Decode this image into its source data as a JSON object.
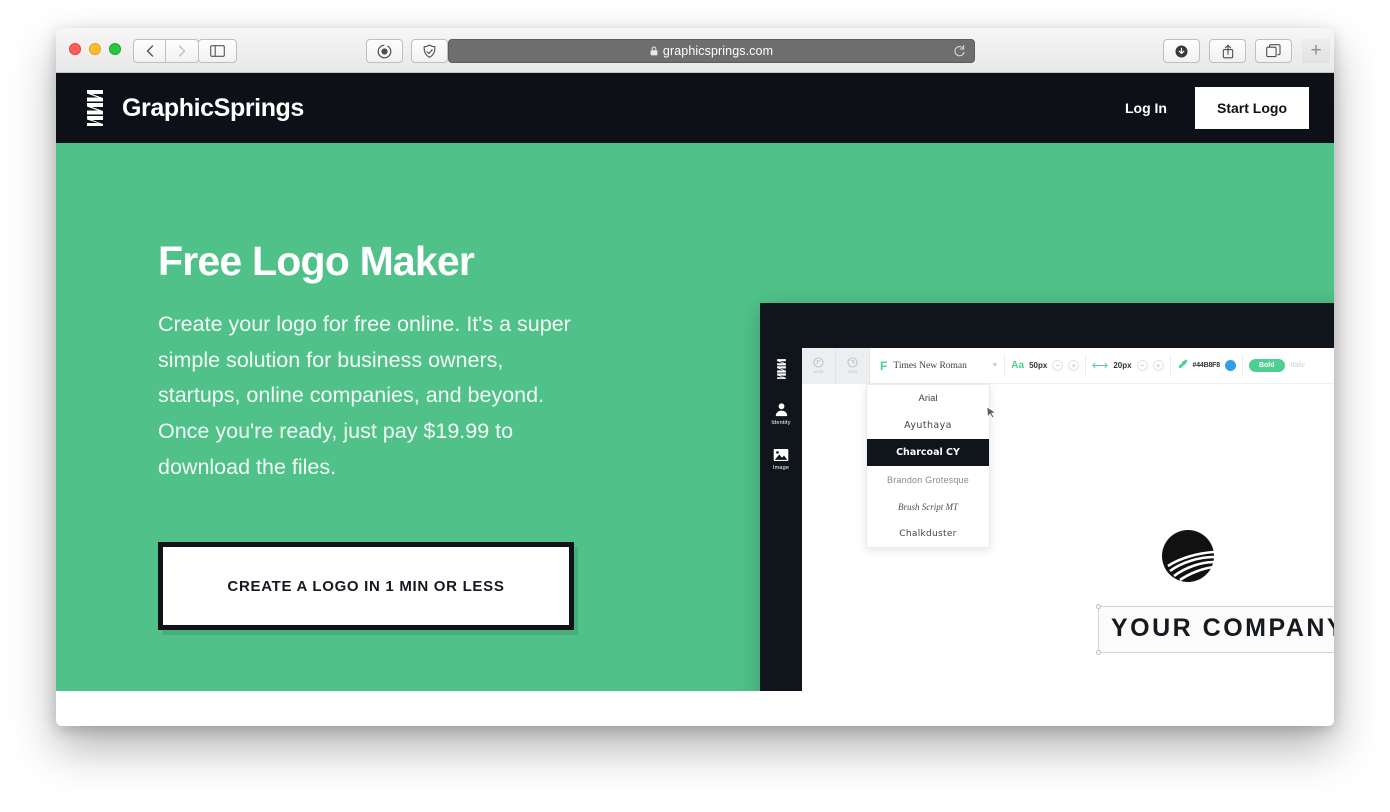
{
  "browser": {
    "url": "graphicsprings.com",
    "lock_icon": "lock-icon",
    "back_icon": "chevron-left-icon",
    "forward_icon": "chevron-right-icon",
    "sidebar_icon": "sidebar-icon",
    "reader_icon": "reader-view-icon",
    "shield_icon": "privacy-shield-icon",
    "reload_icon": "reload-icon",
    "download_icon": "download-icon",
    "share_icon": "share-icon",
    "tabs_icon": "tab-overview-icon",
    "new_tab_label": "+"
  },
  "site_header": {
    "brand_name": "GraphicSprings",
    "logo_icon": "spring-logo-icon",
    "login_label": "Log In",
    "start_logo_label": "Start Logo",
    "background_color": "#0d1117"
  },
  "hero": {
    "title": "Free Logo Maker",
    "paragraph": "Create your logo for free online. It's a super simple solution for business owners, startups, online companies, and beyond. Once you're ready, just pay $19.99 to download the files.",
    "cta_label": "CREATE A LOGO IN 1 MIN OR LESS",
    "background_color": "#50c289",
    "price": "$19.99"
  },
  "app_mockup": {
    "sidebar": {
      "logo_icon": "spring-logo-icon",
      "items": [
        {
          "label": "Identity",
          "icon": "person-icon"
        },
        {
          "label": "Image",
          "icon": "image-icon"
        }
      ]
    },
    "toolbar": {
      "undo_label": "undo",
      "redo_label": "redo",
      "font_icon_label": "F",
      "font_name": "Times New Roman",
      "size_icon_label": "Aa",
      "font_size": "50px",
      "spacing_icon": "arrows-horizontal-icon",
      "letter_spacing": "20px",
      "color_icon": "eyedropper-icon",
      "color_hex": "#44B8F8",
      "color_swatch": "#2f9fe8",
      "bold_label": "Bold",
      "italic_label": "Italic",
      "minus_label": "−",
      "plus_label": "+",
      "caret_icon": "chevron-down-icon",
      "accent_color": "#4ecf92"
    },
    "font_dropdown": {
      "options": [
        {
          "label": "Arial",
          "selected": false
        },
        {
          "label": "Ayuthaya",
          "selected": false
        },
        {
          "label": "Charcoal CY",
          "selected": true
        },
        {
          "label": "Brandon Grotesque",
          "selected": false
        },
        {
          "label": "Brush Script MT",
          "selected": false
        },
        {
          "label": "Chalkduster",
          "selected": false
        }
      ]
    },
    "canvas": {
      "logo_icon": "globe-swoosh-icon",
      "company_text": "YOUR COMPANY",
      "cursor_icon": "pointer-cursor-icon"
    }
  }
}
